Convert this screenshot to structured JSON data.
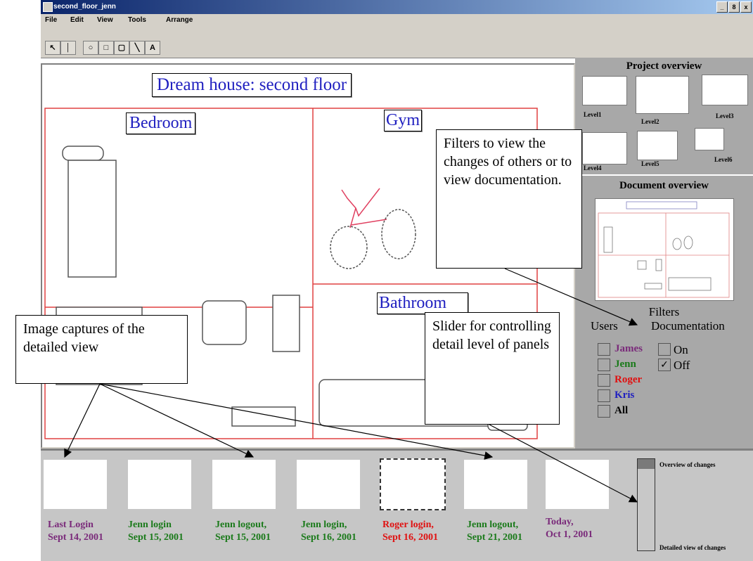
{
  "window": {
    "title": "second_floor_jenn",
    "controls": [
      "_",
      "8",
      "x"
    ]
  },
  "menu": {
    "file": "File",
    "edit": "Edit",
    "view": "View",
    "tools": "Tools",
    "arrange": "Arrange"
  },
  "toolbar": {
    "text_tool": "A"
  },
  "canvas": {
    "title": "Dream house: second floor",
    "rooms": {
      "bedroom": "Bedroom",
      "gym": "Gym",
      "bathroom": "Bathroom"
    }
  },
  "project_overview": {
    "title": "Project overview",
    "levels": [
      "Level1",
      "Level2",
      "Level3",
      "Level4",
      "Level5",
      "Level6"
    ]
  },
  "document_overview": {
    "title": "Document overview"
  },
  "filters": {
    "title": "Filters",
    "users_label": "Users",
    "documentation_label": "Documentation",
    "users": [
      {
        "name": "James",
        "color": "#7a2a7a"
      },
      {
        "name": "Jenn",
        "color": "#1a7a1a"
      },
      {
        "name": "Roger",
        "color": "#e01010"
      },
      {
        "name": "Kris",
        "color": "#2020c0"
      },
      {
        "name": "All",
        "color": "#000000"
      }
    ],
    "documentation": [
      {
        "name": "On",
        "checked": false
      },
      {
        "name": "Off",
        "checked": true
      }
    ]
  },
  "history": [
    {
      "line1": "Last Login",
      "line2": "Sept 14, 2001",
      "color": "#7a2a7a"
    },
    {
      "line1": "Jenn login",
      "line2": "Sept 15, 2001",
      "color": "#1a7a1a"
    },
    {
      "line1": "Jenn logout,",
      "line2": "Sept 15, 2001",
      "color": "#1a7a1a"
    },
    {
      "line1": "Jenn login,",
      "line2": "Sept 16, 2001",
      "color": "#1a7a1a"
    },
    {
      "line1": "Roger login,",
      "line2": "Sept 16, 2001",
      "color": "#e01010"
    },
    {
      "line1": "Jenn logout,",
      "line2": "Sept 21, 2001",
      "color": "#1a7a1a"
    },
    {
      "line1": "Today,",
      "line2": "Oct 1, 2001",
      "color": "#7a2a7a"
    }
  ],
  "slider": {
    "top_label": "Overview of changes",
    "bottom_label": "Detailed view of changes"
  },
  "callouts": {
    "filters": "Filters to view the changes of others or to view documentation.",
    "captures": "Image captures of the detailed view",
    "slider": "Slider for controlling detail level of panels"
  }
}
